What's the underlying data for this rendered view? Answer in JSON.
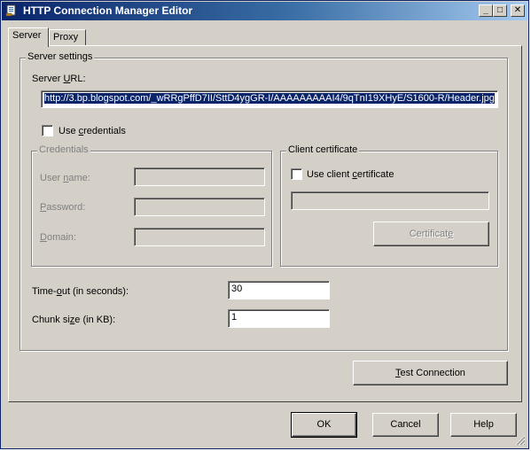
{
  "window": {
    "title": "HTTP Connection Manager Editor",
    "minimize": "_",
    "maximize": "□",
    "close": "✕"
  },
  "tabs": [
    {
      "label": "Server",
      "active": true
    },
    {
      "label": "Proxy",
      "active": false
    }
  ],
  "server_settings": {
    "legend": "Server settings",
    "url_label_pre": "Server ",
    "url_label_u": "U",
    "url_label_post": "RL:",
    "url_value": "http://3.bp.blogspot.com/_wRRgPffD7II/SttD4ygGR-I/AAAAAAAAAI4/9qTnI19XHyE/S1600-R/Header.jpg",
    "use_credentials_pre": "Use ",
    "use_credentials_u": "c",
    "use_credentials_post": "redentials",
    "use_credentials_checked": false
  },
  "credentials": {
    "legend": "Credentials",
    "username_label_pre": "User ",
    "username_label_u": "n",
    "username_label_post": "ame:",
    "password_label_pre": "",
    "password_label_u": "P",
    "password_label_post": "assword:",
    "domain_label_pre": "",
    "domain_label_u": "D",
    "domain_label_post": "omain:",
    "username_value": "",
    "password_value": "",
    "domain_value": ""
  },
  "client_certificate": {
    "legend": "Client certificate",
    "use_cert_pre": "Use client ",
    "use_cert_u": "c",
    "use_cert_post": "ertificate",
    "use_cert_checked": false,
    "cert_value": "",
    "cert_button_pre": "Certificat",
    "cert_button_u": "e",
    "cert_button_post": ""
  },
  "timeout": {
    "label_pre": "Time-",
    "label_u": "o",
    "label_post": "ut (in seconds):",
    "value": "30"
  },
  "chunk": {
    "label_pre": "Chunk si",
    "label_u": "z",
    "label_post": "e (in KB):",
    "value": "1"
  },
  "buttons": {
    "test_connection_pre": "",
    "test_connection_u": "T",
    "test_connection_post": "est Connection",
    "ok": "OK",
    "cancel": "Cancel",
    "help": "Help"
  },
  "colors": {
    "title_gradient_start": "#0a246a",
    "title_gradient_end": "#a6caf0",
    "face": "#d4d0c8",
    "selection": "#0a246a"
  }
}
